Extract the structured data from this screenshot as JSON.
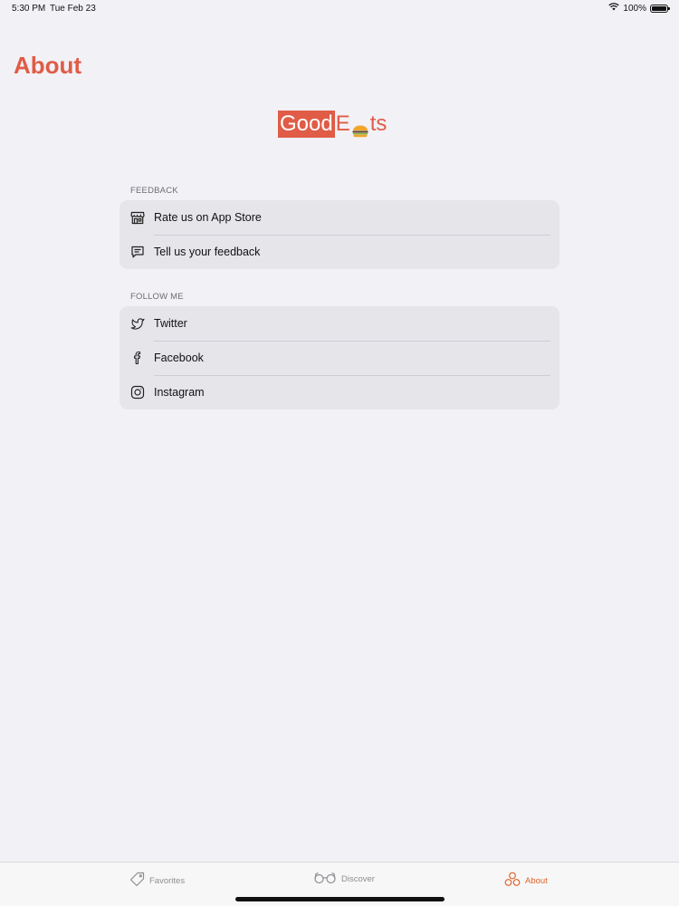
{
  "status_bar": {
    "time": "5:30 PM",
    "date": "Tue Feb 23",
    "battery": "100%"
  },
  "header": {
    "title": "About"
  },
  "logo": {
    "part1": "Good",
    "part2_prefix": "E",
    "part2_suffix": "ts"
  },
  "sections": {
    "feedback": {
      "header": "FEEDBACK",
      "items": [
        {
          "label": "Rate us on App Store",
          "icon": "store-icon"
        },
        {
          "label": "Tell us your feedback",
          "icon": "chat-bubble-icon"
        }
      ]
    },
    "follow": {
      "header": "FOLLOW ME",
      "items": [
        {
          "label": "Twitter",
          "icon": "twitter-icon"
        },
        {
          "label": "Facebook",
          "icon": "facebook-icon"
        },
        {
          "label": "Instagram",
          "icon": "instagram-icon"
        }
      ]
    }
  },
  "tab_bar": {
    "tabs": [
      {
        "label": "Favorites",
        "icon": "tag-icon",
        "active": false
      },
      {
        "label": "Discover",
        "icon": "glasses-icon",
        "active": false
      },
      {
        "label": "About",
        "icon": "circles-icon",
        "active": true
      }
    ]
  },
  "colors": {
    "accent": "#e05c46",
    "tab_active": "#e0642a",
    "background": "#f2f1f6",
    "group_background": "#e6e5ea"
  }
}
